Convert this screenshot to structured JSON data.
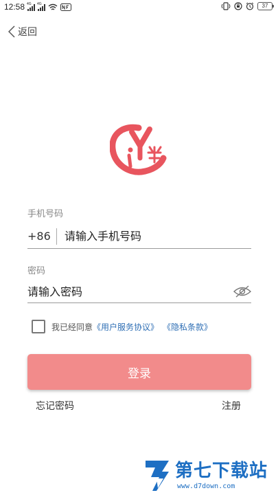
{
  "status_bar": {
    "time": "12:58",
    "signal_labels": [
      "4G",
      "4G"
    ],
    "battery": "37"
  },
  "header": {
    "back_label": "返回"
  },
  "form": {
    "phone_label": "手机号码",
    "country_code": "+86",
    "phone_placeholder": "请输入手机号码",
    "password_label": "密码",
    "password_placeholder": "请输入密码",
    "agree_text": "我已经同意",
    "user_agreement_link": "《用户服务协议》",
    "privacy_link": "《隐私条款》",
    "agree_checked": false,
    "login_label": "登录",
    "forgot_label": "忘记密码",
    "register_label": "注册"
  },
  "colors": {
    "accent": "#f28b8b",
    "link": "#2f6fb5",
    "logo": "#e8555e",
    "watermark": "#1e6fc3"
  },
  "watermark": {
    "title": "第七下载站",
    "url": "www.d7down.com"
  }
}
